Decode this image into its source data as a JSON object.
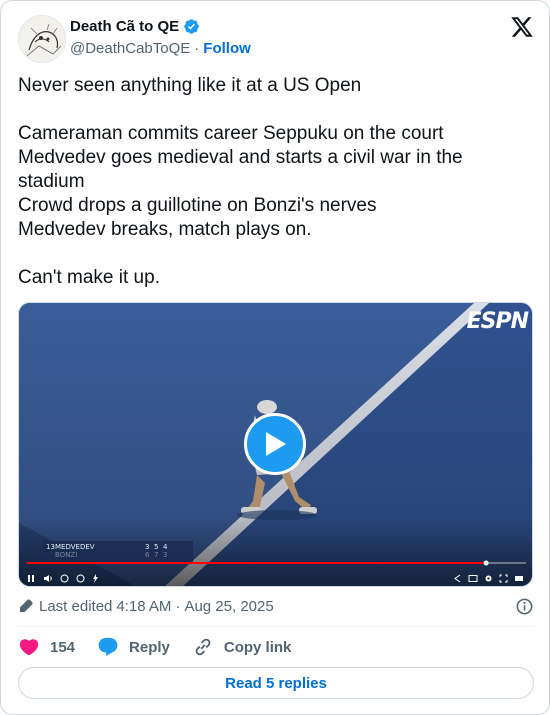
{
  "author": {
    "display_name": "Death Cã to QE",
    "handle": "@DeathCabToQE",
    "separator": "·",
    "follow_label": "Follow",
    "verified": true,
    "verified_color": "#1d9bf0"
  },
  "tweet": {
    "text": "Never seen anything like it at a US Open\n\nCameraman commits career Seppuku on the court\nMedvedev goes medieval and starts a civil war in the stadium\nCrowd drops a guillotine on Bonzi's nerves\nMedvedev breaks, match plays on.\n\nCan't make it up."
  },
  "media": {
    "type": "video",
    "broadcaster_logo": "ESPN",
    "scoreboard": {
      "players": [
        {
          "seed": "13",
          "name": "MEDVEDEV",
          "scores": [
            "3",
            "5",
            "4"
          ]
        },
        {
          "seed": "",
          "name": "BONZI",
          "scores": [
            "6",
            "7",
            "3"
          ]
        }
      ]
    },
    "progress_fraction": 0.92,
    "play_icon": "play-icon",
    "controls": [
      "pause-icon",
      "volume-icon",
      "rewind-10-icon",
      "forward-10-icon",
      "flash-icon",
      "share-icon",
      "captions-icon",
      "gear-icon",
      "fullscreen-icon",
      "theater-icon"
    ]
  },
  "meta": {
    "edit_prefix": "Last edited",
    "time": "4:18 AM",
    "separator": "·",
    "date": "Aug 25, 2025"
  },
  "actions": {
    "like_count": "154",
    "reply_label": "Reply",
    "copy_label": "Copy link"
  },
  "read_replies_label": "Read 5 replies",
  "colors": {
    "accent": "#1d9bf0",
    "link": "#006fd6",
    "heart": "#f91880",
    "reply_bubble": "#1d9bf0",
    "progress": "#ff0000"
  }
}
